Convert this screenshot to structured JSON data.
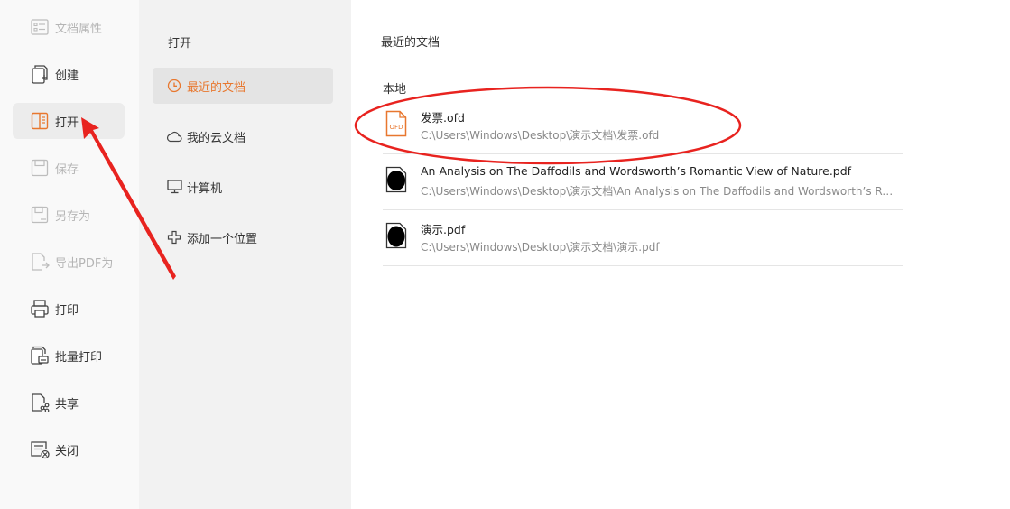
{
  "left_menu": {
    "items": [
      {
        "label": "文档属性",
        "icon": "document-properties-icon",
        "state": "disabled"
      },
      {
        "label": "创建",
        "icon": "create-icon",
        "state": "normal"
      },
      {
        "label": "打开",
        "icon": "open-icon",
        "state": "active"
      },
      {
        "label": "保存",
        "icon": "save-icon",
        "state": "disabled"
      },
      {
        "label": "另存为",
        "icon": "save-as-icon",
        "state": "disabled"
      },
      {
        "label": "导出PDF为",
        "icon": "export-pdf-icon",
        "state": "disabled"
      },
      {
        "label": "打印",
        "icon": "print-icon",
        "state": "normal"
      },
      {
        "label": "批量打印",
        "icon": "batch-print-icon",
        "state": "normal"
      },
      {
        "label": "共享",
        "icon": "share-icon",
        "state": "normal"
      },
      {
        "label": "关闭",
        "icon": "close-doc-icon",
        "state": "normal"
      }
    ]
  },
  "open_panel": {
    "title": "打开",
    "items": [
      {
        "label": "最近的文档",
        "icon": "clock-icon",
        "active": true
      },
      {
        "label": "我的云文档",
        "icon": "cloud-icon",
        "active": false
      },
      {
        "label": "计算机",
        "icon": "monitor-icon",
        "active": false
      },
      {
        "label": "添加一个位置",
        "icon": "plus-icon",
        "active": false
      }
    ]
  },
  "recent": {
    "title": "最近的文档",
    "section": "本地",
    "files": [
      {
        "name": "发票.ofd",
        "path": "C:\\Users\\Windows\\Desktop\\演示文档\\发票.ofd",
        "type": "ofd",
        "icon_text": "OFD"
      },
      {
        "name": "An Analysis on The Daffodils and Wordsworth’s Romantic View of Nature.pdf",
        "path": "C:\\Users\\Windows\\Desktop\\演示文档\\An Analysis on The Daffodils and Wordsworth’s Romantic View of Nature.pdf",
        "type": "pdf"
      },
      {
        "name": "演示.pdf",
        "path": "C:\\Users\\Windows\\Desktop\\演示文档\\演示.pdf",
        "type": "pdf"
      }
    ]
  },
  "colors": {
    "accent": "#e8772e",
    "annotation": "#e8231f",
    "left_bg": "#f9f9f9",
    "mid_bg": "#f2f2f2"
  }
}
